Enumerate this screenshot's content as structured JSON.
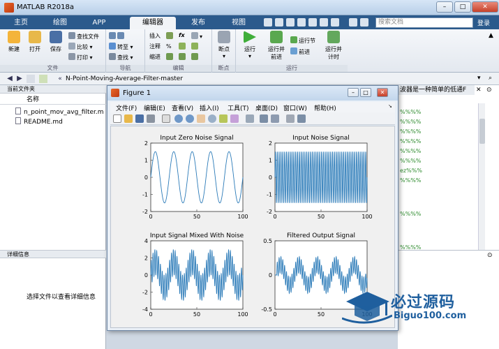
{
  "window": {
    "title": "MATLAB R2018a"
  },
  "tabs": [
    "主页",
    "绘图",
    "APP",
    "编辑器",
    "发布",
    "视图"
  ],
  "search": {
    "placeholder": "搜索文档"
  },
  "login": "登录",
  "ribbon": {
    "file": {
      "new": "新建",
      "open": "打开",
      "save": "保存",
      "find_files": "查找文件",
      "compare": "比较",
      "print": "打印",
      "label": "文件"
    },
    "nav": {
      "goto": "转至",
      "find": "查找",
      "label": "导航"
    },
    "edit": {
      "insert": "插入",
      "comment": "注释",
      "indent": "缩进",
      "label": "编辑"
    },
    "breakpoints": {
      "bp": "断点",
      "label": "断点"
    },
    "run": {
      "run": "运行",
      "run_advance": "运行并\n前进",
      "run_section": "运行节",
      "advance": "前进",
      "run_time": "运行并\n计时",
      "label": "运行"
    }
  },
  "address": {
    "path": "N-Point-Moving-Average-Filter-master"
  },
  "left": {
    "header": "当前文件夹",
    "col_name": "名称",
    "files": [
      "n_point_mov_avg_filter.m",
      "README.md"
    ],
    "details_header": "详细信息",
    "details_msg": "选择文件以查看详细信息"
  },
  "editor": {
    "tab_text": "波器是一种简单的低通F",
    "rows": [
      "%%%%",
      "%%%%",
      "%%%%",
      "%%%%",
      "%%%%",
      "%%%%",
      "ez%%%",
      "%%%%",
      "%%%%",
      "%%%%"
    ]
  },
  "figure": {
    "title": "Figure 1",
    "menu": [
      "文件(F)",
      "编辑(E)",
      "查看(V)",
      "插入(I)",
      "工具(T)",
      "桌面(D)",
      "窗口(W)",
      "帮助(H)"
    ]
  },
  "chart_data": [
    {
      "type": "line",
      "title": "Input Zero Noise Signal",
      "xlim": [
        0,
        100
      ],
      "ylim": [
        -2,
        2
      ],
      "xticks": [
        0,
        50,
        100
      ],
      "yticks": [
        -2,
        -1,
        0,
        1,
        2
      ],
      "signal": "sin",
      "cycles": 5,
      "amplitude": 1.5,
      "color": "#2a7ab8"
    },
    {
      "type": "line",
      "title": "Input Noise Signal",
      "xlim": [
        0,
        100
      ],
      "ylim": [
        -2,
        2
      ],
      "xticks": [
        0,
        50,
        100
      ],
      "yticks": [
        -2,
        -1,
        0,
        1,
        2
      ],
      "signal": "sin",
      "cycles": 50,
      "amplitude": 1.5,
      "color": "#2a7ab8"
    },
    {
      "type": "line",
      "title": "Input Signal Mixed With Noise",
      "xlim": [
        0,
        100
      ],
      "ylim": [
        -4,
        4
      ],
      "xticks": [
        0,
        50,
        100
      ],
      "yticks": [
        -4,
        -2,
        0,
        2,
        4
      ],
      "signal": "mixed",
      "cycles": 5,
      "noise_cycles": 50,
      "amplitude": 1.5,
      "color": "#2a7ab8"
    },
    {
      "type": "line",
      "title": "Filtered Output Signal",
      "xlim": [
        0,
        100
      ],
      "ylim": [
        -0.5,
        0.5
      ],
      "xticks": [
        0,
        50,
        100
      ],
      "yticks": [
        -0.5,
        0,
        0.5
      ],
      "signal": "filtered",
      "cycles": 5,
      "noise_cycles": 50,
      "amplitude": 0.15,
      "noise_amplitude": 0.12,
      "color": "#2a7ab8"
    }
  ],
  "watermark": {
    "text": "必过源码",
    "sub": "Biguo100.com"
  }
}
